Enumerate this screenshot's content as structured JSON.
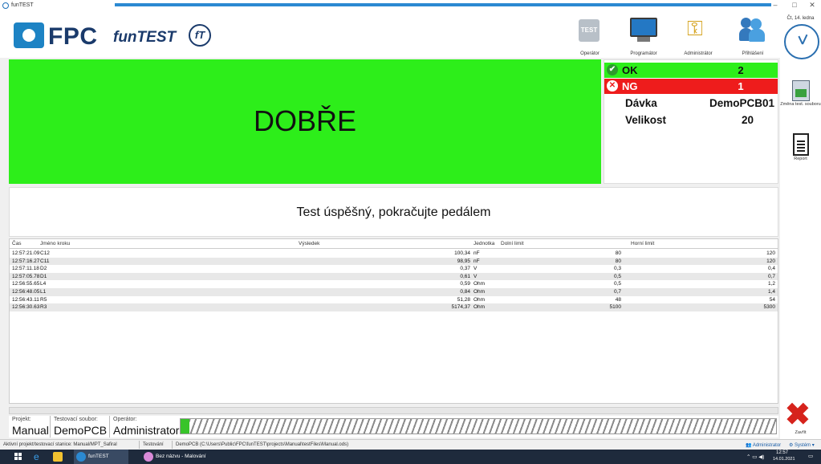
{
  "window": {
    "title": "funTEST",
    "minimize": "–",
    "maximize": "□",
    "close": "✕"
  },
  "header": {
    "logo_fpc": "FPC",
    "logo_funtest": "funTEST",
    "logo_ft": "fT",
    "tools": [
      {
        "label": "Operátor",
        "icon_text": "TEST"
      },
      {
        "label": "Programátor"
      },
      {
        "label": "Administrátor"
      },
      {
        "label": "Přihlášení"
      }
    ]
  },
  "sidebar": {
    "date": "Čt, 14. ledna",
    "file_change_label": "Změna test. souboru",
    "report_label": "Report",
    "close_label": "Zavřít"
  },
  "result": {
    "text": "DOBŘE",
    "color": "#2dee1a"
  },
  "counters": {
    "ok_label": "OK",
    "ok_value": "2",
    "ng_label": "NG",
    "ng_value": "1",
    "batch_label": "Dávka",
    "batch_value": "DemoPCB01",
    "size_label": "Velikost",
    "size_value": "20"
  },
  "message": "Test úspěšný, pokračujte pedálem",
  "table": {
    "headers": {
      "time": "Čas",
      "step": "Jméno kroku",
      "result": "Výsledek",
      "unit": "Jednotka",
      "low": "Dolní limit",
      "high": "Horní limit"
    },
    "rows": [
      {
        "time": "12:57:21.09",
        "step": "C12",
        "result": "100,34",
        "unit": "nF",
        "low": "80",
        "high": "120"
      },
      {
        "time": "12:57:16.27",
        "step": "C11",
        "result": "98,95",
        "unit": "nF",
        "low": "80",
        "high": "120"
      },
      {
        "time": "12:57:11.18",
        "step": "D2",
        "result": "0,37",
        "unit": "V",
        "low": "0,3",
        "high": "0,4"
      },
      {
        "time": "12:57:05.78",
        "step": "D1",
        "result": "0,61",
        "unit": "V",
        "low": "0,5",
        "high": "0,7"
      },
      {
        "time": "12:56:55.65",
        "step": "L4",
        "result": "0,59",
        "unit": "Ohm",
        "low": "0,5",
        "high": "1,2"
      },
      {
        "time": "12:56:48.05",
        "step": "L1",
        "result": "0,84",
        "unit": "Ohm",
        "low": "0,7",
        "high": "1,4"
      },
      {
        "time": "12:56:43.11",
        "step": "R5",
        "result": "51,28",
        "unit": "Ohm",
        "low": "48",
        "high": "54"
      },
      {
        "time": "12:56:30.63",
        "step": "R3",
        "result": "5174,37",
        "unit": "Ohm",
        "low": "5100",
        "high": "5300"
      }
    ]
  },
  "bottom": {
    "project_caption": "Projekt:",
    "project_value": "Manual",
    "testfile_caption": "Testovací soubor:",
    "testfile_value": "DemoPCB",
    "operator_caption": "Operátor:",
    "operator_value": "Administrator",
    "progress_fraction": 0.015
  },
  "statusbar": {
    "active_project": "Aktivní projekt/testovací stanice: Manual/MPT_Safiral",
    "state": "Testování",
    "path": "DemoPCB (C:\\Users\\Public\\FPC\\funTEST\\projects\\Manual\\testFiles\\Manual.ods)",
    "user": "Administrator",
    "system": "Systém"
  },
  "taskbar": {
    "app1": "funTEST",
    "app2": "Bez názvu - Malování",
    "time": "12:57",
    "date": "14.01.2021"
  }
}
